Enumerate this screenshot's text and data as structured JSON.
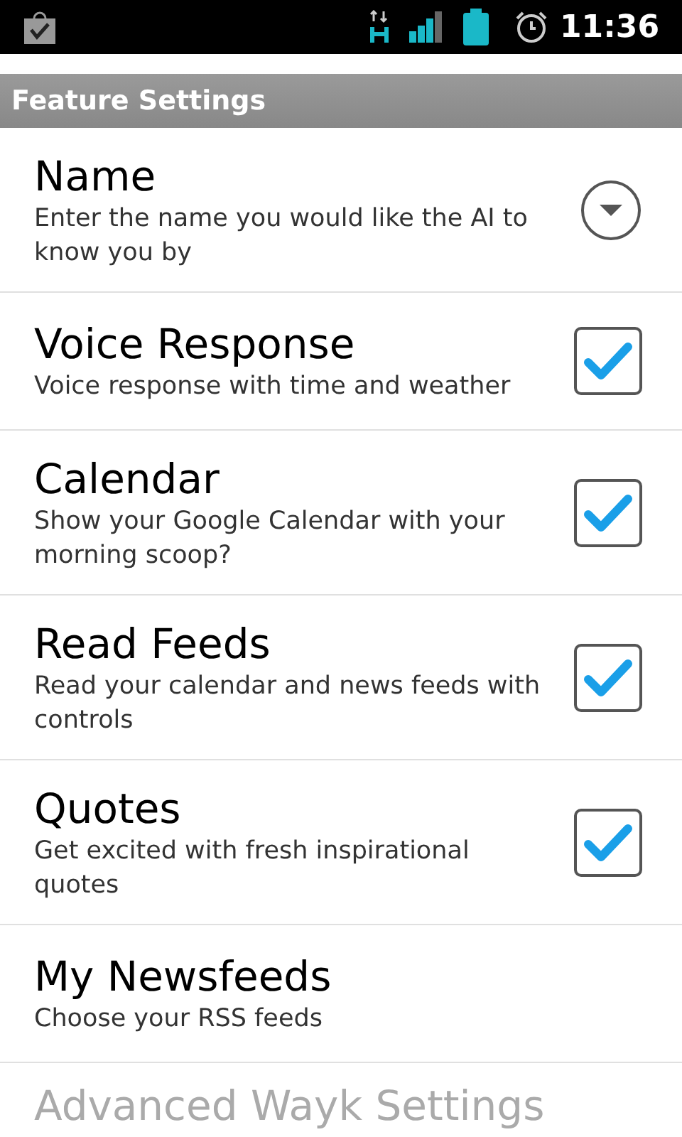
{
  "status_bar": {
    "time": "11:36"
  },
  "category": {
    "title": "Feature Settings"
  },
  "preferences": [
    {
      "kind": "list",
      "title": "Name",
      "summary": "Enter the name you would like the AI to know you by"
    },
    {
      "kind": "checkbox",
      "title": "Voice Response",
      "summary": "Voice response with time and weather",
      "checked": true
    },
    {
      "kind": "checkbox",
      "title": "Calendar",
      "summary": "Show your Google Calendar with your morning scoop?",
      "checked": true
    },
    {
      "kind": "checkbox",
      "title": "Read Feeds",
      "summary": "Read your calendar and news feeds with controls",
      "checked": true
    },
    {
      "kind": "checkbox",
      "title": "Quotes",
      "summary": "Get excited with fresh inspirational quotes",
      "checked": true
    },
    {
      "kind": "plain",
      "title": "My Newsfeeds",
      "summary": "Choose your RSS feeds"
    }
  ],
  "next_item": {
    "title": "Advanced Wayk Settings"
  }
}
